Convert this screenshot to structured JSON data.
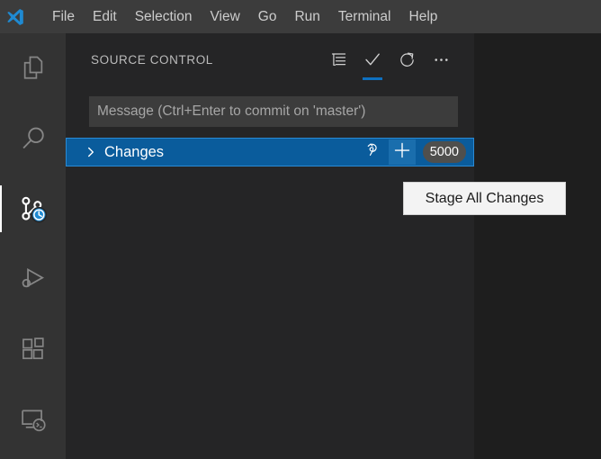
{
  "titlebar": {
    "logo_icon": "vscode-logo-icon",
    "menus": [
      {
        "label": "File"
      },
      {
        "label": "Edit"
      },
      {
        "label": "Selection"
      },
      {
        "label": "View"
      },
      {
        "label": "Go"
      },
      {
        "label": "Run"
      },
      {
        "label": "Terminal"
      },
      {
        "label": "Help"
      }
    ]
  },
  "activitybar": {
    "items": [
      {
        "name": "explorer",
        "icon": "files-icon",
        "active": false
      },
      {
        "name": "search",
        "icon": "search-icon",
        "active": false
      },
      {
        "name": "source-control",
        "icon": "source-control-icon",
        "active": true,
        "badge_icon": "clock-badge-icon"
      },
      {
        "name": "run-and-debug",
        "icon": "run-debug-icon",
        "active": false
      },
      {
        "name": "extensions",
        "icon": "extensions-icon",
        "active": false
      },
      {
        "name": "remote-explorer",
        "icon": "remote-explorer-icon",
        "active": false
      }
    ]
  },
  "sidebar": {
    "title": "SOURCE CONTROL",
    "actions": [
      {
        "name": "view-as-list",
        "icon": "list-view-icon",
        "focused": false
      },
      {
        "name": "commit",
        "icon": "check-icon",
        "focused": true
      },
      {
        "name": "refresh",
        "icon": "refresh-icon",
        "focused": false
      },
      {
        "name": "more-actions",
        "icon": "ellipsis-icon",
        "focused": false
      }
    ],
    "commit_input": {
      "placeholder": "Message (Ctrl+Enter to commit on 'master')",
      "value": ""
    },
    "changes_group": {
      "label": "Changes",
      "expanded": false,
      "chevron_icon": "chevron-right-icon",
      "count": "5000",
      "actions": [
        {
          "name": "discard-all-changes",
          "icon": "discard-icon",
          "hovered": false
        },
        {
          "name": "stage-all-changes",
          "icon": "plus-icon",
          "hovered": true
        }
      ]
    }
  },
  "tooltip": {
    "text": "Stage All Changes"
  },
  "colors": {
    "titlebar_bg": "#3c3c3c",
    "activitybar_bg": "#333333",
    "sidebar_bg": "#252526",
    "editor_bg": "#1e1e1e",
    "selection_blue": "#0a5c9c",
    "accent_blue": "#0e70c0",
    "badge_bg": "#4f4f4d",
    "tooltip_bg": "#f3f3f3",
    "text_primary": "#cccccc"
  }
}
